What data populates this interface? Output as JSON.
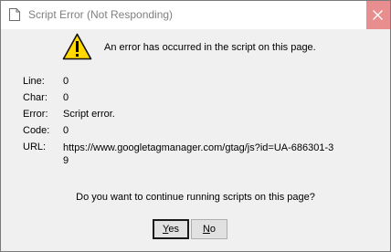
{
  "window": {
    "title": "Script Error (Not Responding)",
    "app_icon": "document-icon",
    "close_icon": "close-icon",
    "close_hover_color": "#e88e8e"
  },
  "message": {
    "icon": "warning-icon",
    "header": "An error has occurred in the script on this page."
  },
  "details": {
    "line_label": "Line:",
    "line_value": "0",
    "char_label": "Char:",
    "char_value": "0",
    "error_label": "Error:",
    "error_value": "Script error.",
    "code_label": "Code:",
    "code_value": "0",
    "url_label": "URL:",
    "url_value": "https://www.googletagmanager.com/gtag/js?id=UA-686301-39"
  },
  "prompt": "Do you want to continue running scripts on this page?",
  "buttons": {
    "yes_accel": "Y",
    "yes_rest": "es",
    "no_accel": "N",
    "no_rest": "o"
  }
}
